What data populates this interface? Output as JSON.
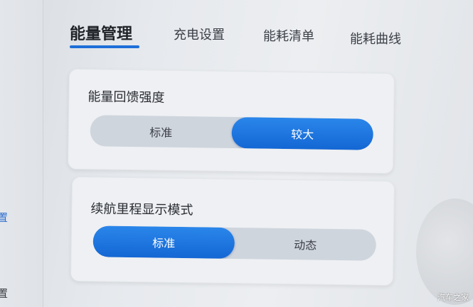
{
  "tabs": [
    {
      "label": "能量管理",
      "active": true
    },
    {
      "label": "充电设置",
      "active": false
    },
    {
      "label": "能耗清单",
      "active": false
    },
    {
      "label": "能耗曲线",
      "active": false
    }
  ],
  "cards": [
    {
      "title": "能量回馈强度",
      "options": [
        "标准",
        "较大"
      ],
      "selected": "较大"
    },
    {
      "title": "续航里程显示模式",
      "options": [
        "标准",
        "动态"
      ],
      "selected": "标准"
    }
  ],
  "sidebar": {
    "partial_item_1": "置",
    "partial_item_2": "置"
  },
  "watermark": "汽车之家",
  "colors": {
    "accent": "#1e6fd9",
    "segment_track": "#cfd5dd",
    "card_bg": "#eef0f3"
  }
}
